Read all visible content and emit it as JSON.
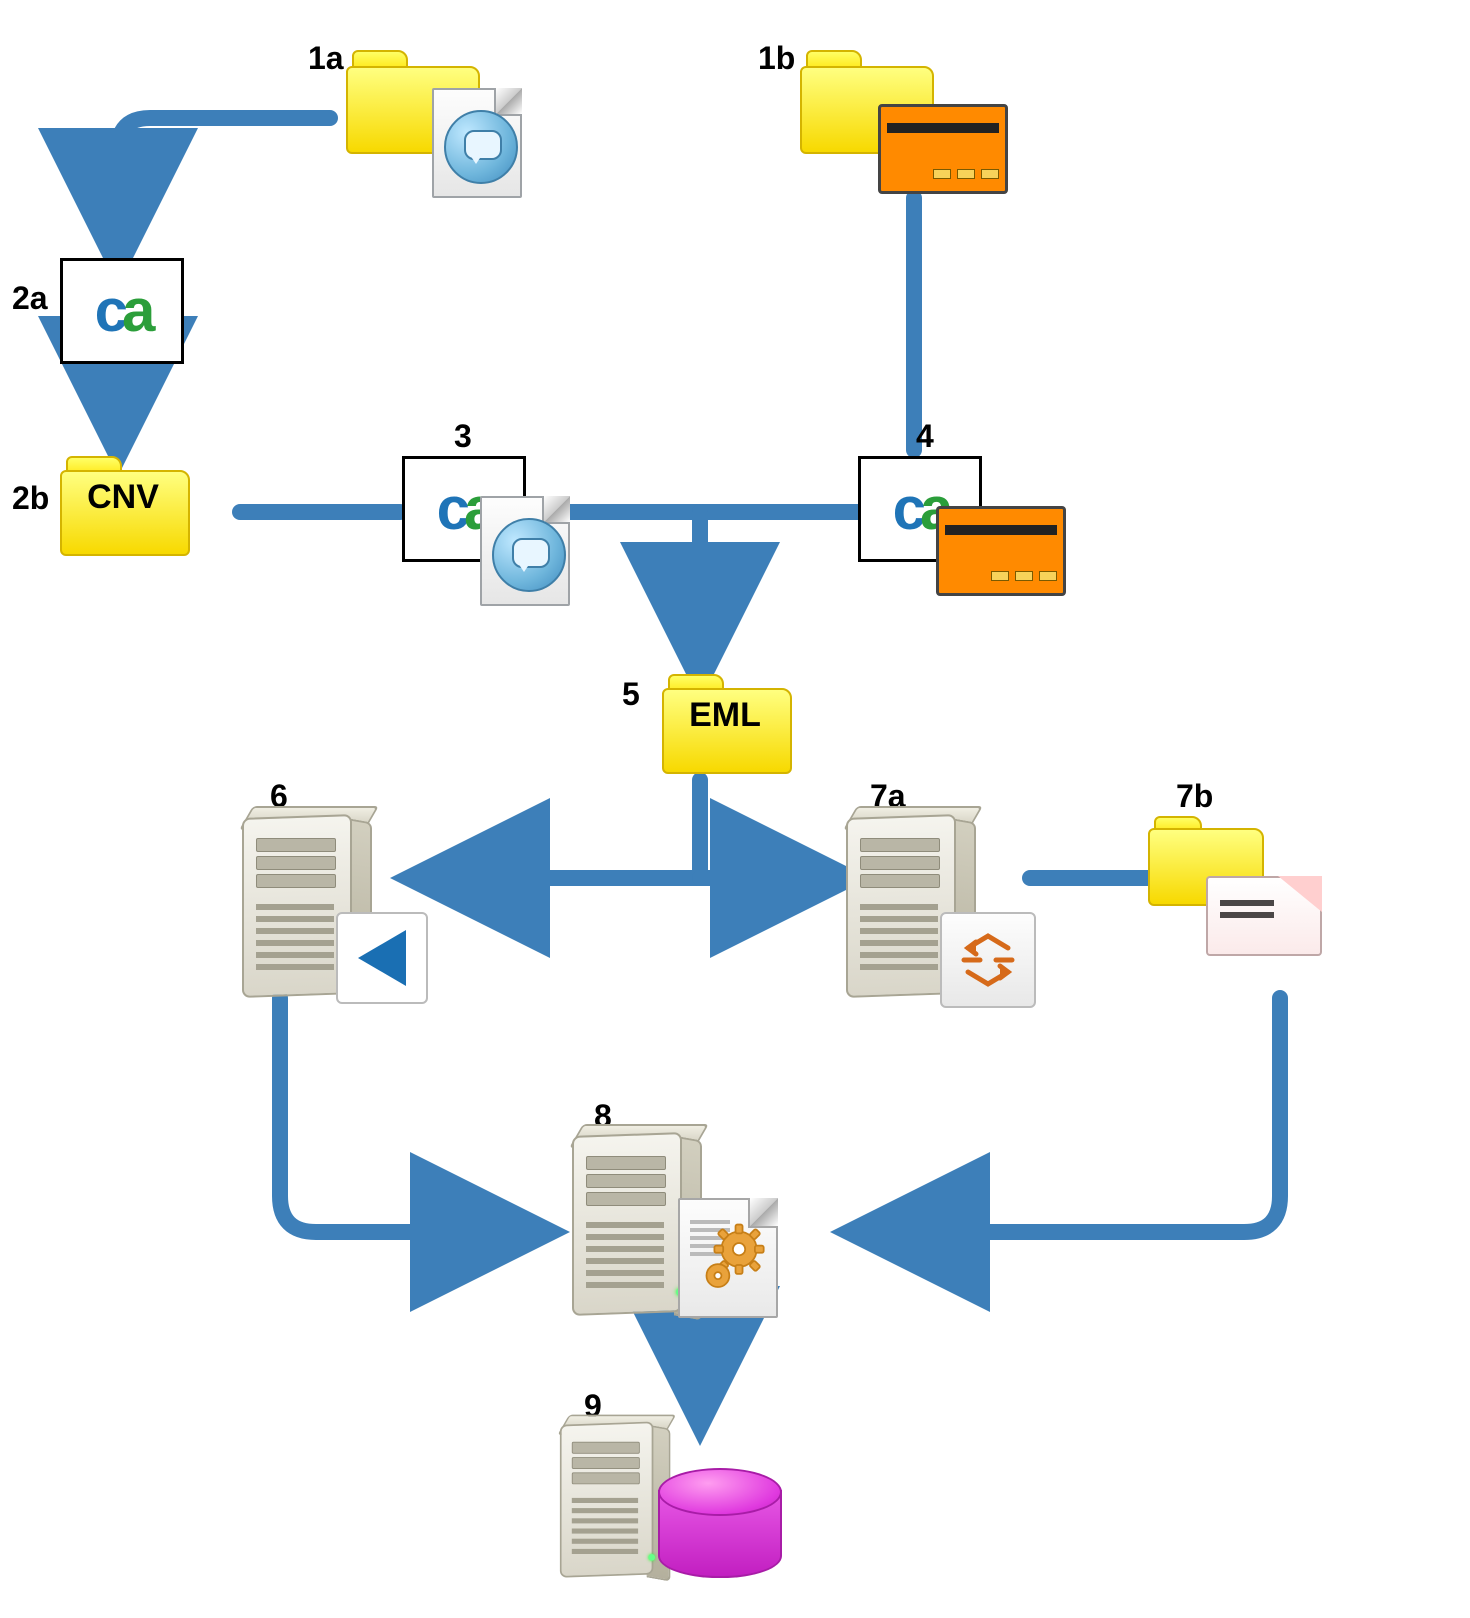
{
  "labels": {
    "n1a": "1a",
    "n1b": "1b",
    "n2a": "2a",
    "n2b": "2b",
    "n3": "3",
    "n4": "4",
    "n5": "5",
    "n6": "6",
    "n7a": "7a",
    "n7b": "7b",
    "n8": "8",
    "n9": "9"
  },
  "folder_text": {
    "n2b": "CNV",
    "n5": "EML"
  },
  "logo": {
    "c": "c",
    "a": "a"
  },
  "colors": {
    "arrow": "#2f6fa9",
    "arrow_fill": "#3d7fb9"
  },
  "chart_data": {
    "type": "flowchart",
    "nodes": [
      {
        "id": "1a",
        "kind": "folder",
        "overlay": "chat-doc"
      },
      {
        "id": "1b",
        "kind": "folder",
        "overlay": "orange-card"
      },
      {
        "id": "2a",
        "kind": "ca-box"
      },
      {
        "id": "2b",
        "kind": "folder",
        "text": "CNV"
      },
      {
        "id": "3",
        "kind": "ca-box",
        "overlay": "chat-doc"
      },
      {
        "id": "4",
        "kind": "ca-box",
        "overlay": "orange-card"
      },
      {
        "id": "5",
        "kind": "folder",
        "text": "EML"
      },
      {
        "id": "6",
        "kind": "server",
        "overlay": "play-badge"
      },
      {
        "id": "7a",
        "kind": "server",
        "overlay": "exchange-badge"
      },
      {
        "id": "7b",
        "kind": "folder",
        "overlay": "envelope"
      },
      {
        "id": "8",
        "kind": "server",
        "overlay": "gears-doc"
      },
      {
        "id": "9",
        "kind": "server",
        "overlay": "database"
      }
    ],
    "edges": [
      {
        "from": "1a",
        "to": "2a"
      },
      {
        "from": "2a",
        "to": "2b"
      },
      {
        "from": "2b",
        "to": "3"
      },
      {
        "from": "1b",
        "to": "4"
      },
      {
        "from": "3",
        "to": "5"
      },
      {
        "from": "4",
        "to": "5"
      },
      {
        "from": "5",
        "to": "6"
      },
      {
        "from": "5",
        "to": "7a"
      },
      {
        "from": "7a",
        "to": "7b"
      },
      {
        "from": "6",
        "to": "8"
      },
      {
        "from": "7b",
        "to": "8"
      },
      {
        "from": "8",
        "to": "9"
      }
    ]
  }
}
